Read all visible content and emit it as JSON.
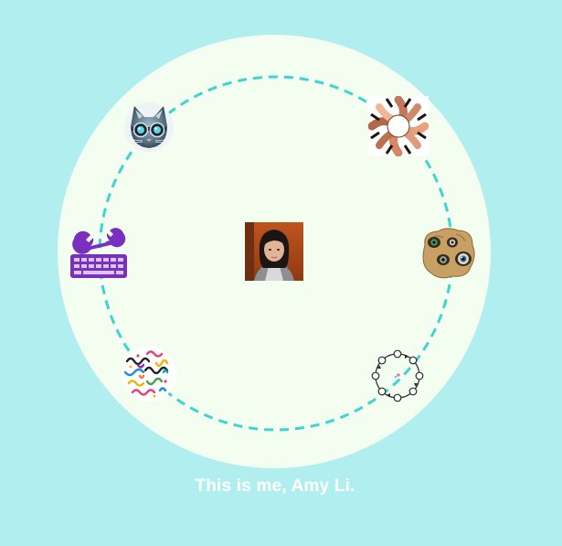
{
  "caption": "This is me, Amy Li.",
  "colors": {
    "background": "#b0eef0",
    "circle_fill": "#f3fdf0",
    "dashed_ring": "#3ed4d0",
    "caption_text": "#ffffff"
  },
  "center": {
    "icon": "portrait-photo"
  },
  "nodes": [
    {
      "icon": "cat-with-goggles-icon"
    },
    {
      "icon": "interlocking-hands-icon"
    },
    {
      "icon": "eyes-in-rock-icon"
    },
    {
      "icon": "graph-network-icon"
    },
    {
      "icon": "colorful-squiggles-icon"
    },
    {
      "icon": "wrench-keyboard-icon"
    }
  ]
}
